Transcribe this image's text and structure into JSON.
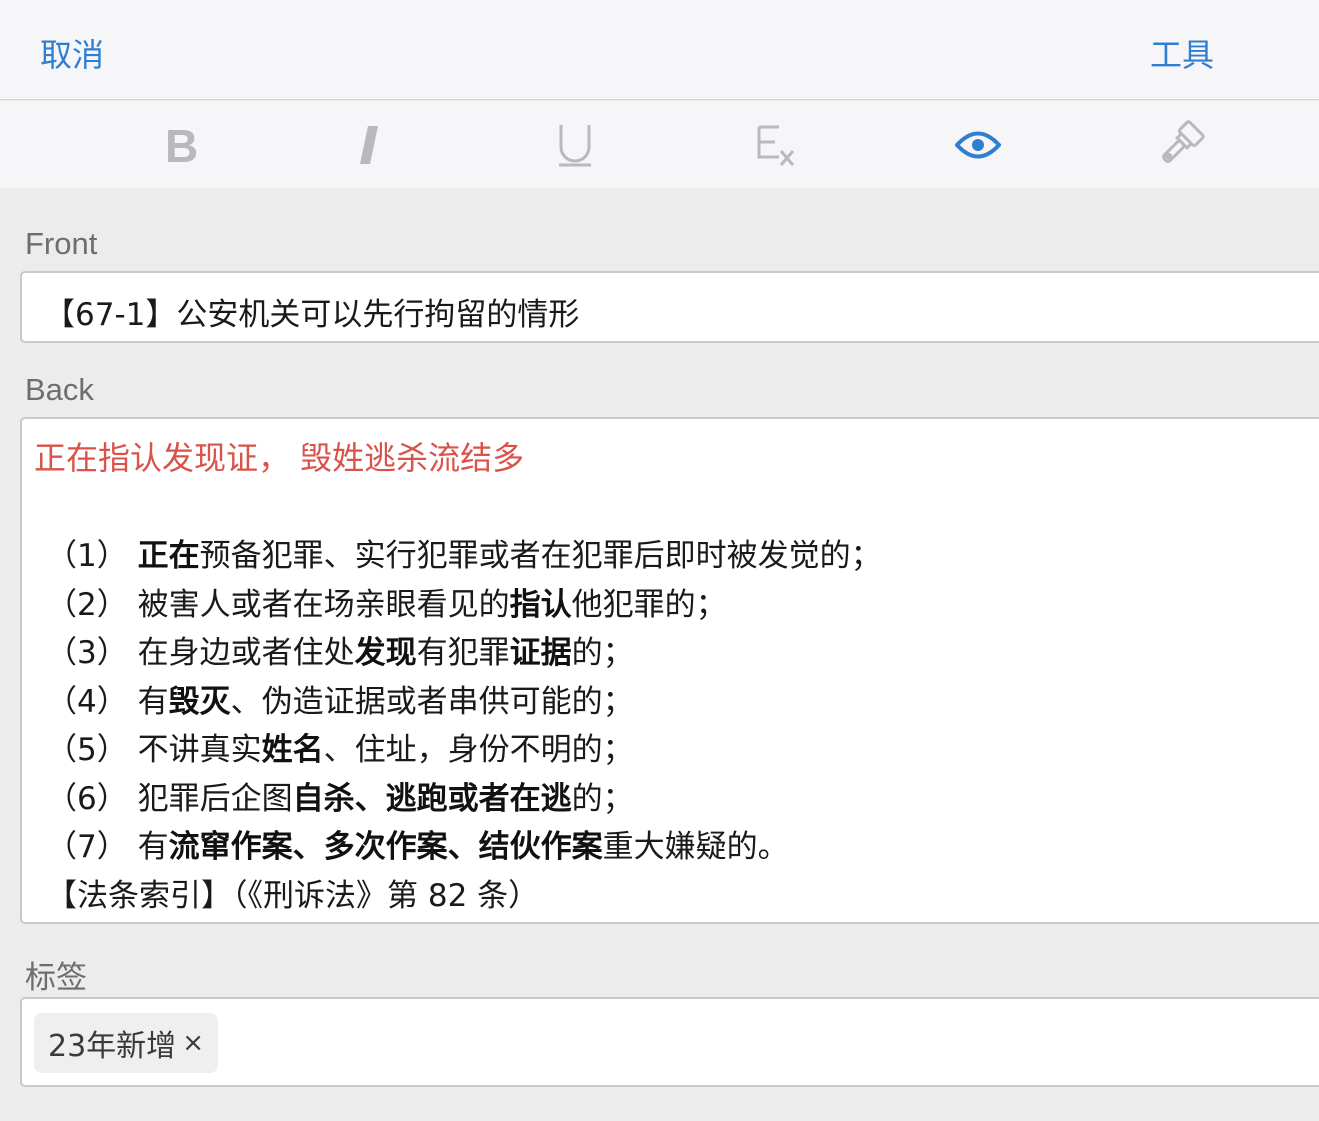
{
  "header": {
    "cancel_label": "取消",
    "tools_label": "工具"
  },
  "toolbar": {
    "bold_icon": "bold-icon",
    "italic_icon": "italic-icon",
    "underline_icon": "underline-icon",
    "clear_format_icon": "clear-format-icon",
    "preview_icon": "eye-icon",
    "format_painter_icon": "paint-brush-icon",
    "active_color": "#2f7fd0",
    "inactive_color": "#b9b9bd"
  },
  "front": {
    "label": "Front",
    "value": "【67-1】公安机关可以先行拘留的情形"
  },
  "back": {
    "label": "Back",
    "summary": "正在指认发现证， 毁姓逃杀流结多",
    "summary_color": "#d9534a",
    "lines": [
      [
        {
          "t": "（1） ",
          "b": false
        },
        {
          "t": "正在",
          "b": true
        },
        {
          "t": "预备犯罪、实行犯罪或者在犯罪后即时被发觉的；",
          "b": false
        }
      ],
      [
        {
          "t": "（2） 被害人或者在场亲眼看见的",
          "b": false
        },
        {
          "t": "指认",
          "b": true
        },
        {
          "t": "他犯罪的；",
          "b": false
        }
      ],
      [
        {
          "t": "（3） 在身边或者住处",
          "b": false
        },
        {
          "t": "发现",
          "b": true
        },
        {
          "t": "有犯罪",
          "b": false
        },
        {
          "t": "证据",
          "b": true
        },
        {
          "t": "的；",
          "b": false
        }
      ],
      [
        {
          "t": "（4） 有",
          "b": false
        },
        {
          "t": "毁灭",
          "b": true
        },
        {
          "t": "、伪造证据或者串供可能的；",
          "b": false
        }
      ],
      [
        {
          "t": "（5） 不讲真实",
          "b": false
        },
        {
          "t": "姓名",
          "b": true
        },
        {
          "t": "、住址，身份不明的；",
          "b": false
        }
      ],
      [
        {
          "t": "（6） 犯罪后企图",
          "b": false
        },
        {
          "t": "自杀、逃跑或者在逃",
          "b": true
        },
        {
          "t": "的；",
          "b": false
        }
      ],
      [
        {
          "t": "（7） 有",
          "b": false
        },
        {
          "t": "流窜作案、多次作案、结伙作案",
          "b": true
        },
        {
          "t": "重大嫌疑的。",
          "b": false
        }
      ],
      [
        {
          "t": "【法条索引】（《刑诉法》第 82 条）",
          "b": false
        }
      ]
    ]
  },
  "tags": {
    "label": "标签",
    "items": [
      {
        "label": "23年新增",
        "remove": "×"
      }
    ]
  }
}
